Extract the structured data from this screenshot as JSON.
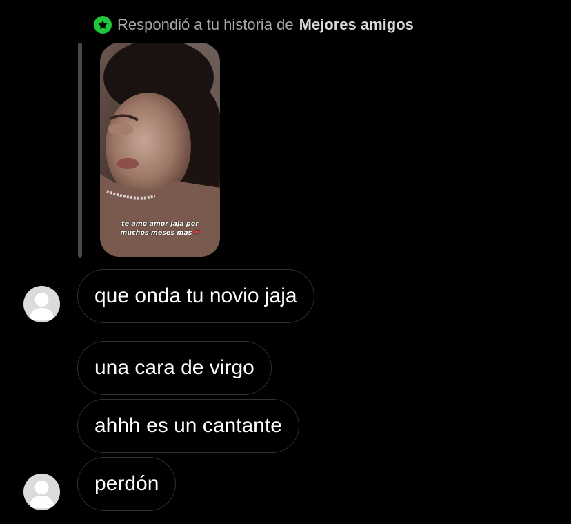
{
  "reply_header": {
    "prefix": "Respondió a tu historia de",
    "list_name": "Mejores amigos",
    "badge_icon": "star-icon",
    "badge_color": "#1ec63a"
  },
  "story": {
    "caption_line1": "te amo amor jaja por",
    "caption_line2": "muchos meses mas",
    "caption_heart": "❤"
  },
  "messages": [
    {
      "text": "que onda tu novio jaja"
    },
    {
      "text": "una cara de virgo"
    },
    {
      "text": "ahhh es un cantante"
    },
    {
      "text": "perdón"
    }
  ],
  "colors": {
    "background": "#000000",
    "bubble_border": "#303030",
    "header_text": "#a8a8a8",
    "avatar_placeholder": "#dbdbdb"
  }
}
